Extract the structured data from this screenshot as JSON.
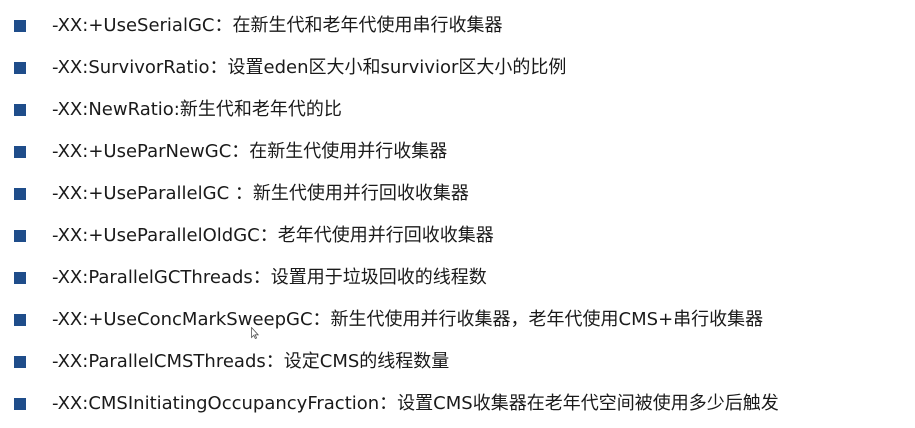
{
  "slide": {
    "items": [
      {
        "text": "-XX:+UseSerialGC：在新生代和老年代使用串行收集器"
      },
      {
        "text": "-XX:SurvivorRatio：设置eden区大小和survivior区大小的比例"
      },
      {
        "text": "-XX:NewRatio:新生代和老年代的比"
      },
      {
        "text": "-XX:+UseParNewGC：在新生代使用并行收集器"
      },
      {
        "text": "-XX:+UseParallelGC  ：新生代使用并行回收收集器"
      },
      {
        "text": "-XX:+UseParallelOldGC：老年代使用并行回收收集器"
      },
      {
        "text": "-XX:ParallelGCThreads：设置用于垃圾回收的线程数"
      },
      {
        "text": "-XX:+UseConcMarkSweepGC：新生代使用并行收集器，老年代使用CMS+串行收集器"
      },
      {
        "text": "-XX:ParallelCMSThreads：设定CMS的线程数量"
      },
      {
        "text": "-XX:CMSInitiatingOccupancyFraction：设置CMS收集器在老年代空间被使用多少后触发"
      }
    ],
    "colors": {
      "bullet": "#1f4d8a",
      "text": "#1a1a1a",
      "background": "#ffffff"
    }
  }
}
